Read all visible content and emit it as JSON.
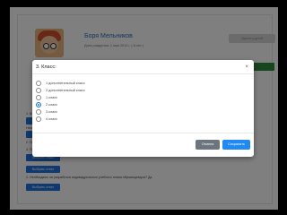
{
  "profile": {
    "name": "Боря Мельников",
    "dob": "Дата рождения: 1 мая 2014 г. ( 8 лет )",
    "delete_label": "Удалить детей"
  },
  "background": {
    "rows": [
      "1. Класс: 1 дополнительный класс",
      "Необходимо выбрать класс",
      "2. Программа: 1",
      "3. Прочие:",
      "2. Необходимо ли разработка индивидуального учебного плана обучающемуся? Да"
    ],
    "choose_label": "Выбрать класс",
    "choose_label_2": "Выбрать ответ"
  },
  "modal": {
    "title": "3. Класс:",
    "close_glyph": "×",
    "options": [
      {
        "label": "1 дополнительный класс",
        "checked": false
      },
      {
        "label": "2 дополнительный класс",
        "checked": false
      },
      {
        "label": "1 класс",
        "checked": false
      },
      {
        "label": "2 класс",
        "checked": true
      },
      {
        "label": "3 класс",
        "checked": false
      },
      {
        "label": "4 класс",
        "checked": false
      }
    ],
    "cancel_label": "Отмена",
    "save_label": "Сохранить"
  },
  "colors": {
    "primary": "#1f73e0",
    "save": "#1f8bf2",
    "cancel": "#6c757d",
    "tag_orange": "#e28f26",
    "tag_gray": "#7a8794",
    "tag_green": "#2f8a3b"
  }
}
